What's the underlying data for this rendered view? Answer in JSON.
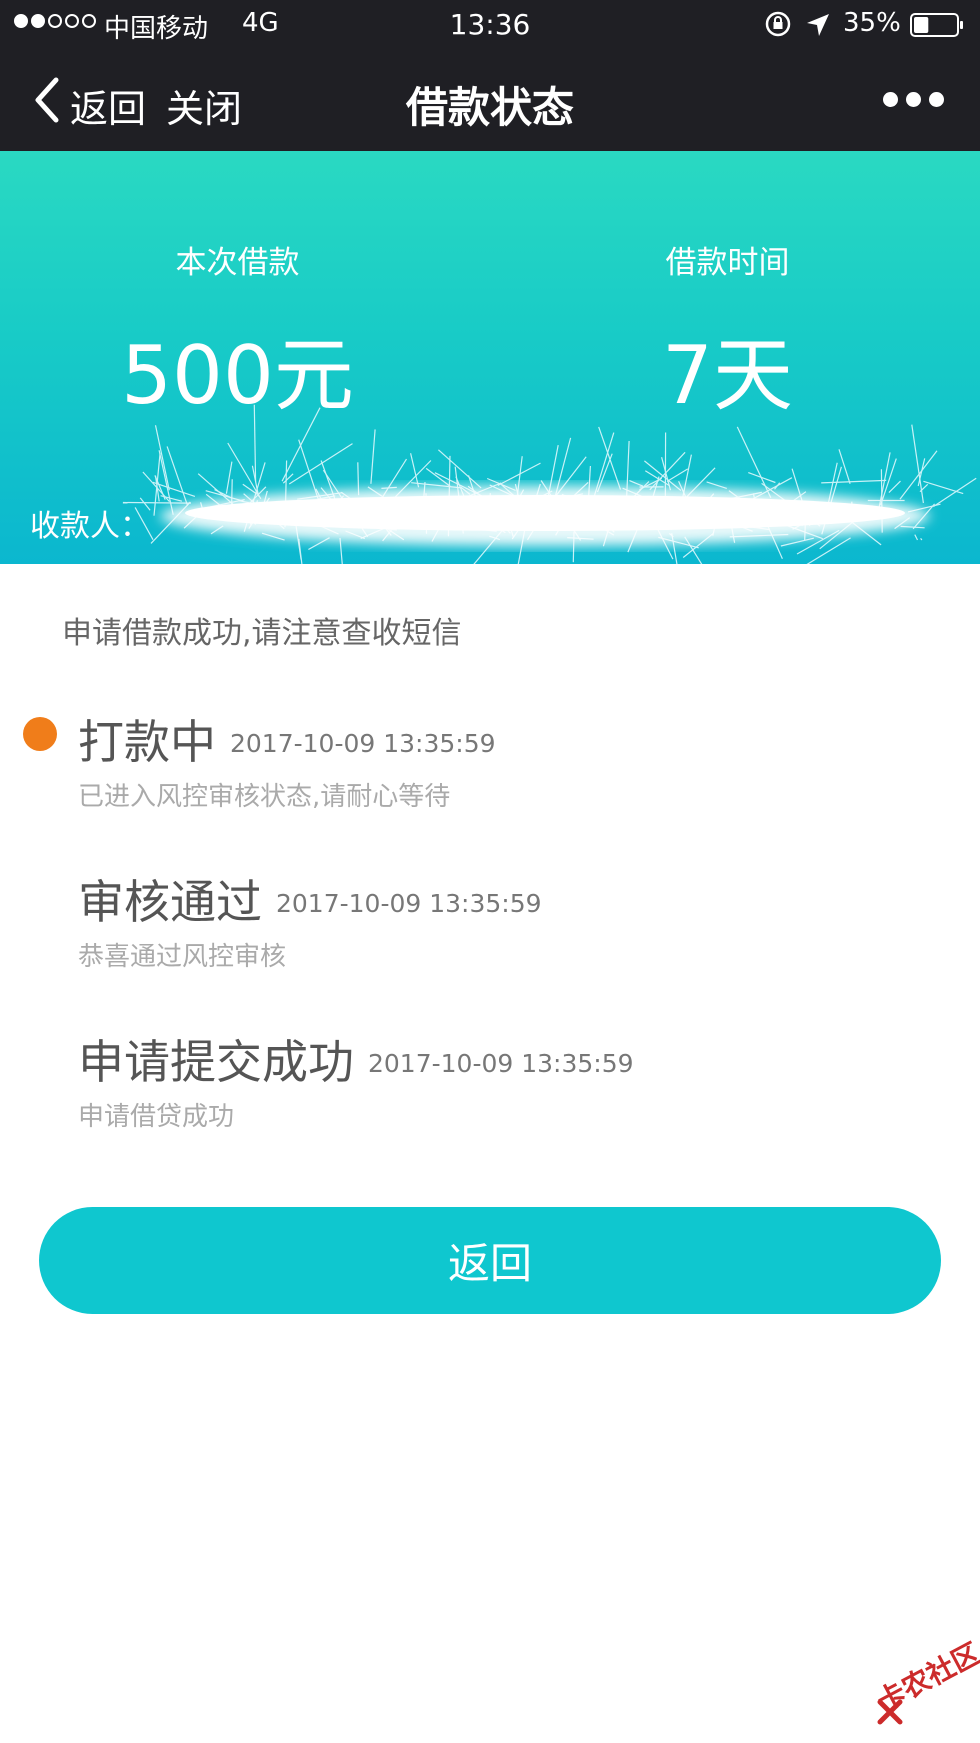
{
  "status_bar": {
    "carrier": "中国移动",
    "network": "4G",
    "time": "13:36",
    "battery_percent": "35%",
    "battery_level": 0.35
  },
  "nav": {
    "back_label": "返回",
    "close_label": "关闭",
    "title": "借款状态"
  },
  "banner": {
    "amount_label": "本次借款",
    "amount_value": "500元",
    "term_label": "借款时间",
    "term_value": "7天",
    "payee_label": "收款人："
  },
  "notice": "申请借款成功,请注意查收短信",
  "timeline": [
    {
      "title": "打款中",
      "time": "2017-10-09 13:35:59",
      "desc": "已进入风控审核状态,请耐心等待",
      "active": true
    },
    {
      "title": "审核通过",
      "time": "2017-10-09 13:35:59",
      "desc": "恭喜通过风控审核",
      "active": false
    },
    {
      "title": "申请提交成功",
      "time": "2017-10-09 13:35:59",
      "desc": "申请借贷成功",
      "active": false
    }
  ],
  "return_button": "返回",
  "watermark": "卡农社区",
  "colors": {
    "nav_bg": "#1f1f24",
    "banner_top": "#2ad9c2",
    "banner_bottom": "#0bb7cf",
    "active_dot": "#f07d1a",
    "button": "#0fc7cf"
  }
}
